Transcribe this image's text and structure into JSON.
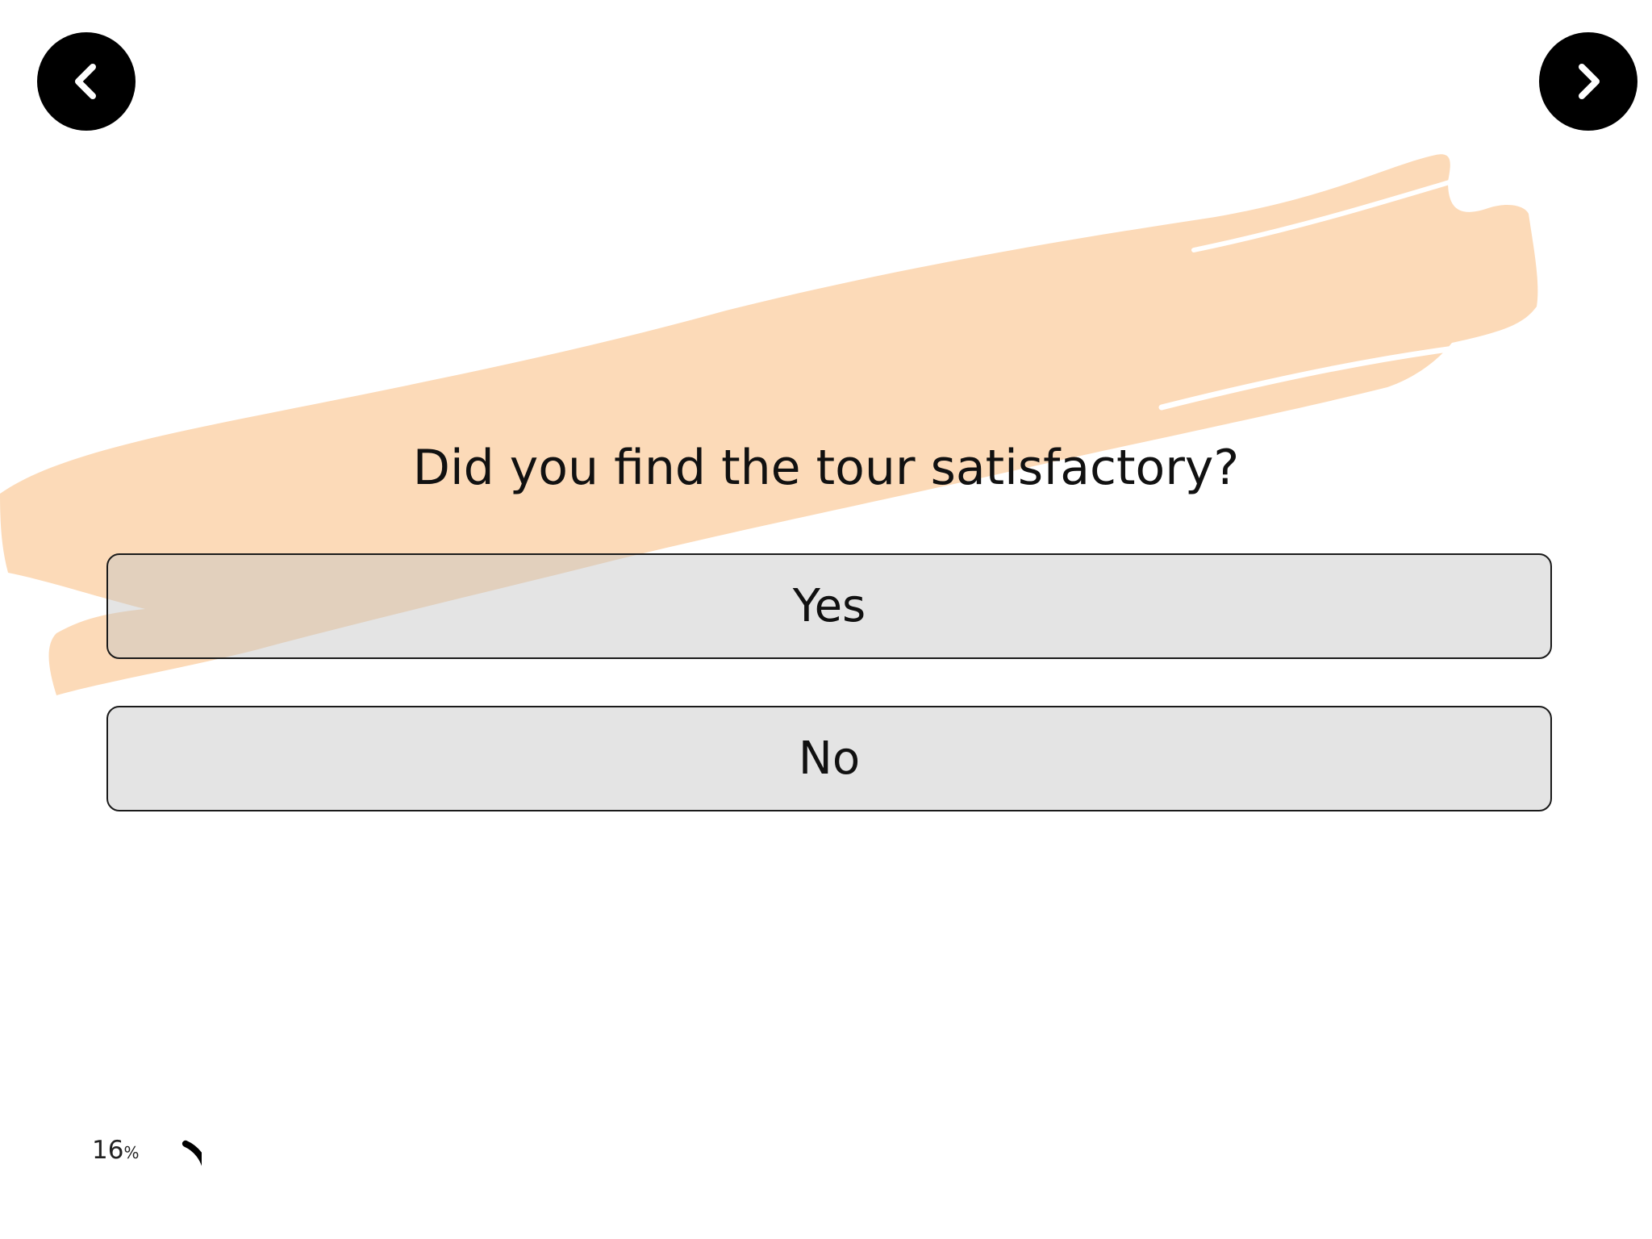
{
  "navigation": {
    "prev_icon": "chevron-left-icon",
    "next_icon": "chevron-right-icon"
  },
  "survey": {
    "question": "Did you find the tour satisfactory?",
    "options": [
      {
        "label": "Yes"
      },
      {
        "label": "No"
      }
    ]
  },
  "progress": {
    "value": "16",
    "unit": "%",
    "fraction": 0.16
  },
  "colors": {
    "accent_brush": "#fbd4ab",
    "option_fill": "#e4e4e4",
    "nav_button": "#000000"
  }
}
